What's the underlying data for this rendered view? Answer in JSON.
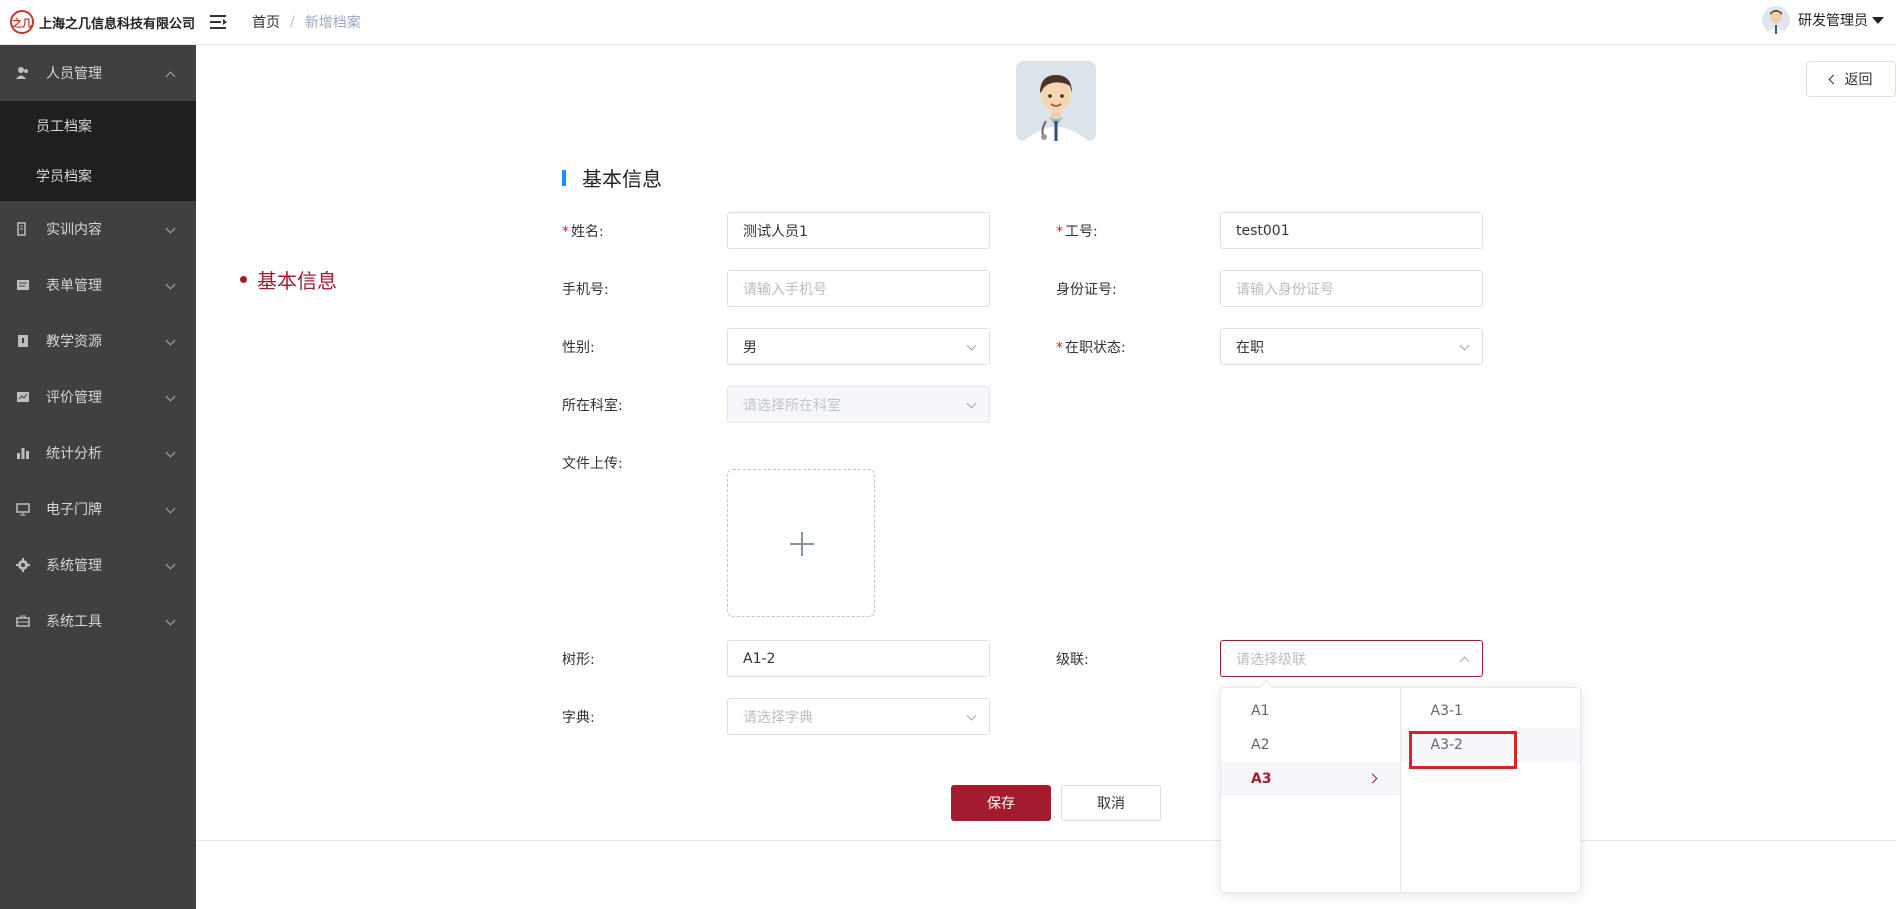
{
  "header": {
    "company": "上海之几信息科技有限公司",
    "logo_mark": "之几",
    "breadcrumb": {
      "home": "首页",
      "separator": "/",
      "current": "新增档案"
    },
    "user": "研发管理员"
  },
  "sidebar": {
    "items": [
      {
        "label": "人员管理",
        "icon": "user-icon",
        "expanded": true,
        "children": [
          {
            "label": "员工档案"
          },
          {
            "label": "学员档案"
          }
        ]
      },
      {
        "label": "实训内容",
        "icon": "book-icon"
      },
      {
        "label": "表单管理",
        "icon": "form-icon"
      },
      {
        "label": "教学资源",
        "icon": "resource-icon"
      },
      {
        "label": "评价管理",
        "icon": "evaluation-icon"
      },
      {
        "label": "统计分析",
        "icon": "chart-icon"
      },
      {
        "label": "电子门牌",
        "icon": "monitor-icon"
      },
      {
        "label": "系统管理",
        "icon": "gear-icon"
      },
      {
        "label": "系统工具",
        "icon": "toolbox-icon"
      }
    ]
  },
  "main": {
    "back_label": "返回",
    "anchor": "基本信息",
    "section_title": "基本信息",
    "form": {
      "name": {
        "label": "姓名:",
        "value": "测试人员1",
        "required": true
      },
      "job_no": {
        "label": "工号:",
        "value": "test001",
        "required": true
      },
      "phone": {
        "label": "手机号:",
        "placeholder": "请输入手机号"
      },
      "id_card": {
        "label": "身份证号:",
        "placeholder": "请输入身份证号"
      },
      "gender": {
        "label": "性别:",
        "value": "男"
      },
      "status": {
        "label": "在职状态:",
        "value": "在职",
        "required": true
      },
      "department": {
        "label": "所在科室:",
        "placeholder": "请选择所在科室"
      },
      "upload": {
        "label": "文件上传:"
      },
      "tree": {
        "label": "树形:",
        "value": "A1-2"
      },
      "cascade": {
        "label": "级联:",
        "placeholder": "请选择级联"
      },
      "dict": {
        "label": "字典:",
        "placeholder": "请选择字典"
      }
    },
    "save_label": "保存",
    "cancel_label": "取消",
    "cascader": {
      "level1": [
        "A1",
        "A2",
        "A3"
      ],
      "level1_active": "A3",
      "level2": [
        "A3-1",
        "A3-2"
      ],
      "level2_hover": "A3-2"
    }
  }
}
